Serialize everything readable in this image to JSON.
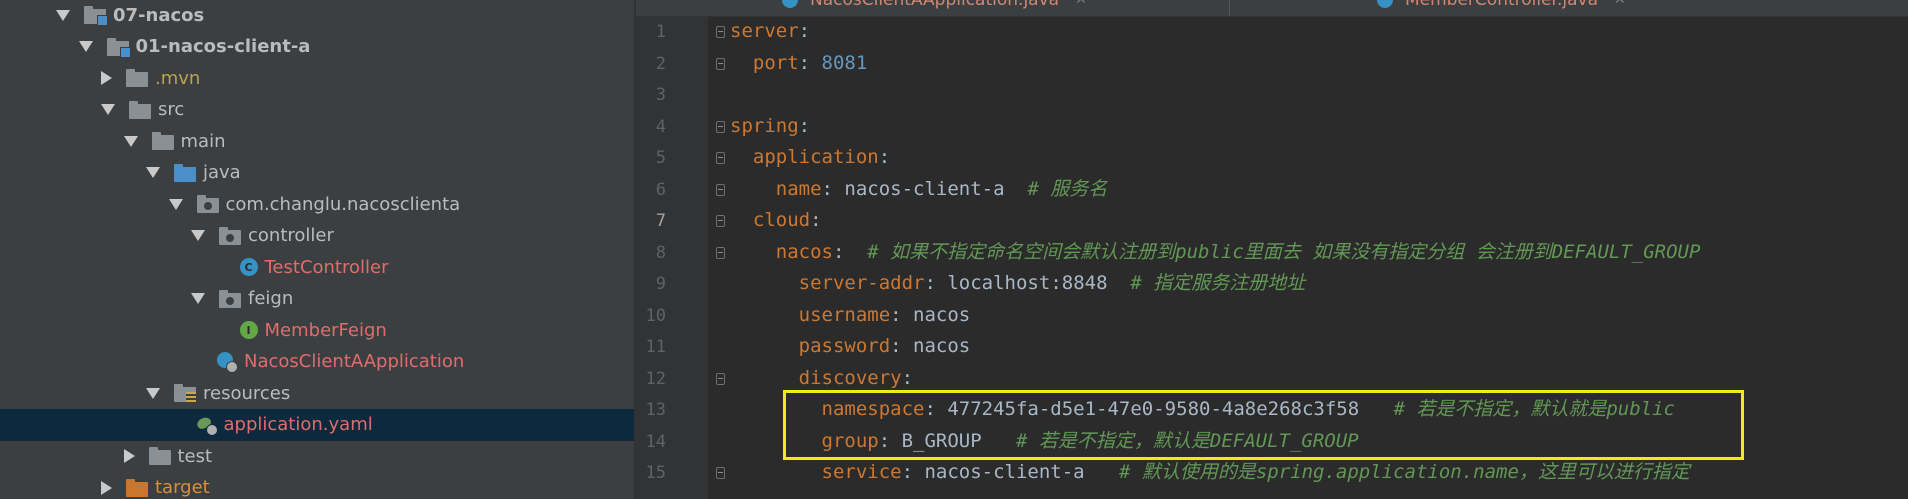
{
  "project_tree": {
    "items": [
      {
        "label": "07-nacos",
        "kind": "module-folder",
        "expanded": true,
        "bold": true,
        "color": "gray"
      },
      {
        "label": "01-nacos-client-a",
        "kind": "module-folder",
        "expanded": true,
        "bold": true,
        "color": "gray"
      },
      {
        "label": ".mvn",
        "kind": "folder",
        "expanded": false,
        "color": "olive"
      },
      {
        "label": "src",
        "kind": "folder",
        "expanded": true,
        "color": "gray"
      },
      {
        "label": "main",
        "kind": "folder",
        "expanded": true,
        "color": "gray"
      },
      {
        "label": "java",
        "kind": "source-folder",
        "expanded": true,
        "color": "gray"
      },
      {
        "label": "com.changlu.nacosclienta",
        "kind": "package",
        "expanded": true,
        "color": "gray"
      },
      {
        "label": "controller",
        "kind": "package",
        "expanded": true,
        "color": "gray"
      },
      {
        "label": "TestController",
        "kind": "class",
        "color": "red"
      },
      {
        "label": "feign",
        "kind": "package",
        "expanded": true,
        "color": "gray"
      },
      {
        "label": "MemberFeign",
        "kind": "interface",
        "color": "red"
      },
      {
        "label": "NacosClientAApplication",
        "kind": "spring-app",
        "color": "red"
      },
      {
        "label": "resources",
        "kind": "resources-folder",
        "expanded": true,
        "color": "gray"
      },
      {
        "label": "application.yaml",
        "kind": "yaml",
        "color": "red",
        "selected": true
      },
      {
        "label": "test",
        "kind": "folder",
        "expanded": false,
        "color": "gray"
      },
      {
        "label": "target",
        "kind": "excluded-folder",
        "expanded": false,
        "color": "orange"
      }
    ]
  },
  "editor": {
    "tabs": [
      {
        "label": "NacosClientAApplication.java",
        "icon": "spring-class-icon"
      },
      {
        "label": "MemberController.java",
        "icon": "class-icon"
      }
    ],
    "current_line": 7,
    "lines": [
      {
        "num": "1",
        "tokens": [
          [
            "k",
            "server"
          ],
          [
            "p",
            ":"
          ]
        ]
      },
      {
        "num": "2",
        "tokens": [
          [
            "p",
            "  "
          ],
          [
            "k",
            "port"
          ],
          [
            "p",
            ": "
          ],
          [
            "n",
            "8081"
          ]
        ]
      },
      {
        "num": "3",
        "tokens": []
      },
      {
        "num": "4",
        "tokens": [
          [
            "k",
            "spring"
          ],
          [
            "p",
            ":"
          ]
        ]
      },
      {
        "num": "5",
        "tokens": [
          [
            "p",
            "  "
          ],
          [
            "k",
            "application"
          ],
          [
            "p",
            ":"
          ]
        ]
      },
      {
        "num": "6",
        "tokens": [
          [
            "p",
            "    "
          ],
          [
            "k",
            "name"
          ],
          [
            "p",
            ": nacos-client-a  "
          ],
          [
            "c",
            "# 服务名"
          ]
        ]
      },
      {
        "num": "7",
        "tokens": [
          [
            "p",
            "  "
          ],
          [
            "k",
            "cloud"
          ],
          [
            "p",
            ":"
          ]
        ]
      },
      {
        "num": "8",
        "tokens": [
          [
            "p",
            "    "
          ],
          [
            "k",
            "nacos"
          ],
          [
            "p",
            ":  "
          ],
          [
            "c",
            "# 如果不指定命名空间会默认注册到public里面去 如果没有指定分组 会注册到DEFAULT_GROUP"
          ]
        ]
      },
      {
        "num": "9",
        "tokens": [
          [
            "p",
            "      "
          ],
          [
            "k",
            "server-addr"
          ],
          [
            "p",
            ": localhost:8848  "
          ],
          [
            "c",
            "# 指定服务注册地址"
          ]
        ]
      },
      {
        "num": "10",
        "tokens": [
          [
            "p",
            "      "
          ],
          [
            "k",
            "username"
          ],
          [
            "p",
            ": nacos"
          ]
        ]
      },
      {
        "num": "11",
        "tokens": [
          [
            "p",
            "      "
          ],
          [
            "k",
            "password"
          ],
          [
            "p",
            ": nacos"
          ]
        ]
      },
      {
        "num": "12",
        "tokens": [
          [
            "p",
            "      "
          ],
          [
            "k",
            "discovery"
          ],
          [
            "p",
            ":"
          ]
        ]
      },
      {
        "num": "13",
        "tokens": [
          [
            "p",
            "        "
          ],
          [
            "k",
            "namespace"
          ],
          [
            "p",
            ": 477245fa-d5e1-47e0-9580-4a8e268c3f58   "
          ],
          [
            "c",
            "# 若是不指定，默认就是public"
          ]
        ]
      },
      {
        "num": "14",
        "tokens": [
          [
            "p",
            "        "
          ],
          [
            "k",
            "group"
          ],
          [
            "p",
            ": B_GROUP   "
          ],
          [
            "c",
            "# 若是不指定，默认是DEFAULT_GROUP"
          ]
        ]
      },
      {
        "num": "15",
        "tokens": [
          [
            "p",
            "        "
          ],
          [
            "k",
            "service"
          ],
          [
            "p",
            ": nacos-client-a   "
          ],
          [
            "c",
            "# 默认使用的是spring.application.name，这里可以进行指定"
          ]
        ]
      }
    ],
    "highlight_color": "#f0eb14"
  }
}
